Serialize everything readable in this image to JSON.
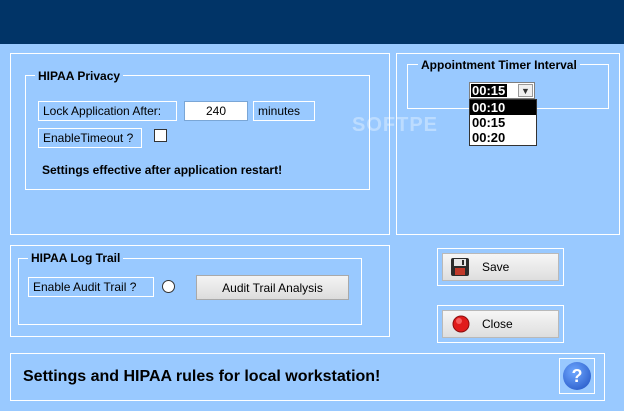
{
  "hipaa_privacy": {
    "title": "HIPAA Privacy",
    "lock_label": "Lock Application After:",
    "lock_value": "240",
    "lock_unit": "minutes",
    "timeout_label": "EnableTimeout ?",
    "timeout_checked": false,
    "note": "Settings effective after application restart!"
  },
  "appointment_timer": {
    "title": "Appointment Timer Interval",
    "selected": "00:15",
    "options": [
      "00:10",
      "00:15",
      "00:20"
    ],
    "highlighted": "00:10"
  },
  "hipaa_log": {
    "title": "HIPAA Log Trail",
    "audit_label": "Enable Audit Trail ?",
    "audit_enabled": false,
    "analysis_button": "Audit Trail Analysis"
  },
  "actions": {
    "save_label": "Save",
    "close_label": "Close"
  },
  "footer": {
    "text": "Settings and HIPAA rules for local workstation!",
    "help_glyph": "?"
  },
  "watermark": "SOFTPE",
  "colors": {
    "header": "#013467",
    "background": "#99c9ff"
  },
  "icons": {
    "save": "floppy-disk-icon",
    "close": "red-circle-icon",
    "help": "help-icon"
  }
}
